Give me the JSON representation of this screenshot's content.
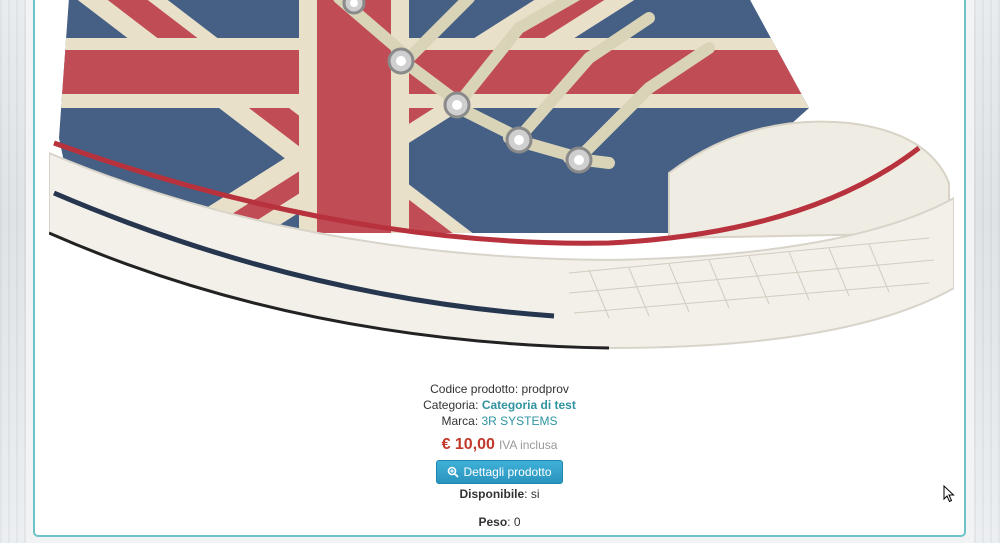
{
  "product": {
    "image_alt": "Union Jack high-top sneaker",
    "code_label": "Codice prodotto",
    "code_value": "prodprov",
    "category_label": "Categoria",
    "category_value": "Categoria di test",
    "brand_label": "Marca",
    "brand_value": "3R SYSTEMS",
    "price": "€ 10,00",
    "vat_note": "IVA inclusa",
    "details_button_label": "Dettagli prodotto",
    "availability_label": "Disponibile",
    "availability_value": "si",
    "weight_label": "Peso",
    "weight_value": "0"
  },
  "icons": {
    "details": "zoom-in-icon",
    "cursor": "mouse-pointer-icon"
  },
  "colors": {
    "card_border": "#6dc3c8",
    "link": "#2f93a0",
    "price": "#c0392b",
    "button": "#3fb0d8"
  }
}
